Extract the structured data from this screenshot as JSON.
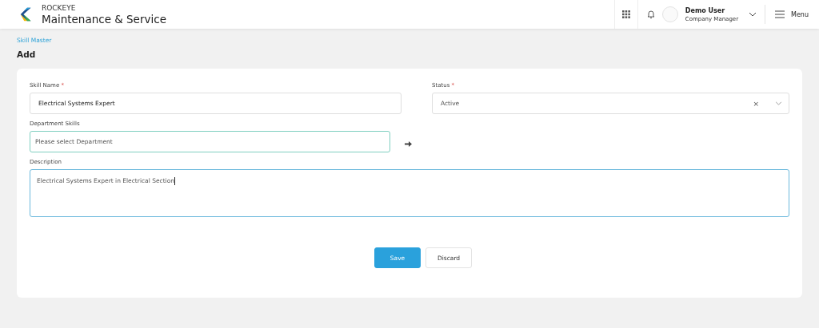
{
  "header": {
    "brand_top": "ROCKEYE",
    "brand_title": "Maintenance & Service",
    "user_name": "Demo User",
    "user_role": "Company Manager",
    "menu_label": "Menu"
  },
  "breadcrumb": "Skill Master",
  "page_title": "Add",
  "form": {
    "skill_name": {
      "label": "Skill Name",
      "required_mark": "*",
      "value": "Electrical Systems Expert"
    },
    "status": {
      "label": "Status",
      "required_mark": "*",
      "value": "Active",
      "clear": "×"
    },
    "department_skills": {
      "label": "Department Skills",
      "placeholder": "Please select Department"
    },
    "description": {
      "label": "Description",
      "value": "Electrical Systems Expert in Electrical Section"
    }
  },
  "buttons": [
    {
      "label": "Save",
      "kind": "primary"
    },
    {
      "label": "Discard",
      "kind": "secondary"
    }
  ]
}
